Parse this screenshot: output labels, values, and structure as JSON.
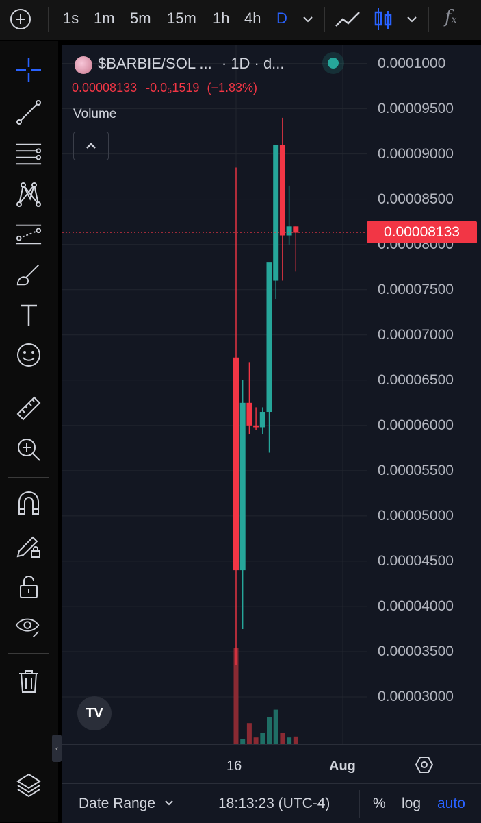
{
  "toolbar": {
    "intervals": [
      "1s",
      "1m",
      "5m",
      "15m",
      "1h",
      "4h",
      "D"
    ],
    "active_interval": "D",
    "icons": [
      "plus-icon",
      "chevron-down-icon",
      "line-chart-icon",
      "candles-icon",
      "chevron-down-icon",
      "fx-icon"
    ]
  },
  "sidebar": {
    "tools": [
      "crosshair-icon",
      "trendline-icon",
      "fib-lines-icon",
      "pattern-icon",
      "prediction-icon",
      "brush-icon",
      "text-icon",
      "emoji-icon",
      "ruler-icon",
      "zoom-in-icon",
      "magnet-icon",
      "pencil-lock-icon",
      "unlock-icon",
      "eye-icon",
      "trash-icon",
      "layers-icon"
    ]
  },
  "legend": {
    "symbol": "$BARBIE/SOL ...",
    "interval": "· 1D · d...",
    "last": "0.00008133",
    "change": "-0.0₅1519",
    "change_pct": "(−1.83%)",
    "volume_label": "Volume"
  },
  "chart_data": {
    "type": "candlestick",
    "price_ticks": [
      "0.0001000",
      "0.00009500",
      "0.00009000",
      "0.00008500",
      "0.00008000",
      "0.00007500",
      "0.00007000",
      "0.00006500",
      "0.00006000",
      "0.00005500",
      "0.00005000",
      "0.00004500",
      "0.00004000",
      "0.00003500",
      "0.00003000"
    ],
    "ylim": [
      2.75e-05,
      0.0001005
    ],
    "last_price": "0.00008133",
    "x_ticks": [
      "16",
      "Aug"
    ],
    "candles": [
      {
        "o": 6.75e-05,
        "h": 8.85e-05,
        "l": 3.35e-05,
        "c": 4.4e-05
      },
      {
        "o": 4.4e-05,
        "h": 6.5e-05,
        "l": 3.75e-05,
        "c": 6.25e-05
      },
      {
        "o": 6.25e-05,
        "h": 6.7e-05,
        "l": 5.9e-05,
        "c": 6e-05
      },
      {
        "o": 6e-05,
        "h": 6.2e-05,
        "l": 5.95e-05,
        "c": 5.98e-05
      },
      {
        "o": 5.98e-05,
        "h": 6.2e-05,
        "l": 5.9e-05,
        "c": 6.15e-05
      },
      {
        "o": 6.15e-05,
        "h": 6.75e-05,
        "l": 5.7e-05,
        "c": 7.8e-05
      },
      {
        "o": 7.6e-05,
        "h": 8.6e-05,
        "l": 7.4e-05,
        "c": 9.1e-05
      },
      {
        "o": 9.1e-05,
        "h": 9.4e-05,
        "l": 7.6e-05,
        "c": 8.1e-05
      },
      {
        "o": 8.1e-05,
        "h": 8.65e-05,
        "l": 8e-05,
        "c": 8.2e-05
      },
      {
        "o": 8.2e-05,
        "h": 8.2e-05,
        "l": 7.7e-05,
        "c": 8.13e-05
      }
    ],
    "volumes": [
      1.0,
      0.05,
      0.22,
      0.07,
      0.12,
      0.28,
      0.36,
      0.12,
      0.07,
      0.08
    ],
    "colors": {
      "up": "#26a69a",
      "down": "#f23645"
    }
  },
  "bottom": {
    "date_range": "Date Range",
    "time": "18:13:23 (UTC-4)",
    "percent": "%",
    "log": "log",
    "auto": "auto"
  },
  "watermark": "TV"
}
